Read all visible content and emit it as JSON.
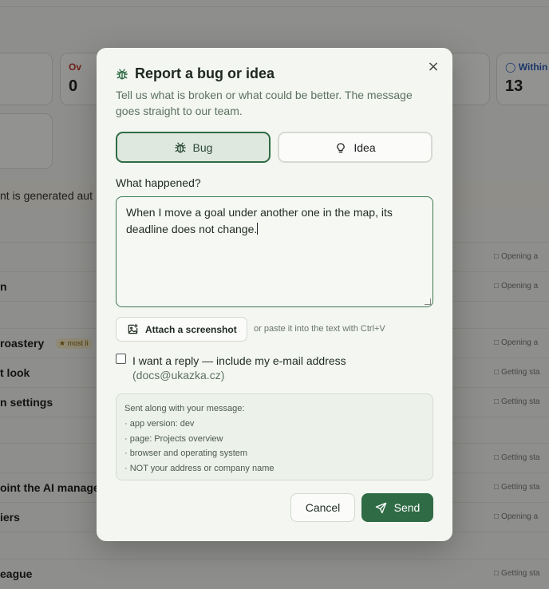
{
  "background": {
    "stats": [
      {
        "label": "Ov",
        "value": "0",
        "color": "#c0392b"
      },
      {
        "label": "Within",
        "value": "13",
        "color": "#2f5fb3"
      }
    ],
    "banner_text": "nt is generated aut",
    "rows": [
      {
        "title": "",
        "meta": "Opening a"
      },
      {
        "title": "n",
        "meta": "Opening a"
      },
      {
        "title": "",
        "meta": ""
      },
      {
        "title": "roastery",
        "badge": "most li",
        "meta": "Opening a"
      },
      {
        "title": "t look",
        "meta": "Getting sta"
      },
      {
        "title": "n settings",
        "meta": "Getting sta"
      },
      {
        "title": "",
        "meta": ""
      },
      {
        "title": "",
        "meta": "Getting sta"
      },
      {
        "title": "oint the AI manage",
        "meta": "Getting sta"
      },
      {
        "title": "iers",
        "meta": "Opening a"
      },
      {
        "title": "",
        "meta": ""
      },
      {
        "title": "eague",
        "meta": "Getting sta"
      }
    ]
  },
  "dialog": {
    "title": "Report a bug or idea",
    "subtitle": "Tell us what is broken or what could be better. The message goes straight to our team.",
    "close_icon": "×",
    "types": {
      "bug_label": "Bug",
      "idea_label": "Idea",
      "selected": "Bug"
    },
    "field_label": "What happened?",
    "message": "When I move a goal under another one in the map, its deadline does not change.",
    "attach_label": "Attach a screenshot",
    "attach_hint": "or paste it into the text with Ctrl+V",
    "reply_label": "I want a reply — include my e-mail address",
    "reply_email": "(docs@ukazka.cz)",
    "reply_checked": false,
    "info": {
      "title": "Sent along with your message:",
      "items": [
        "· app version: dev",
        "· page: Projects overview",
        "· browser and operating system",
        "· NOT your address or company name"
      ]
    },
    "cancel_label": "Cancel",
    "send_label": "Send"
  },
  "colors": {
    "accent": "#2f6b45",
    "subtitle": "#5c7161",
    "overlay": "rgba(0,0,0,0.42)"
  }
}
